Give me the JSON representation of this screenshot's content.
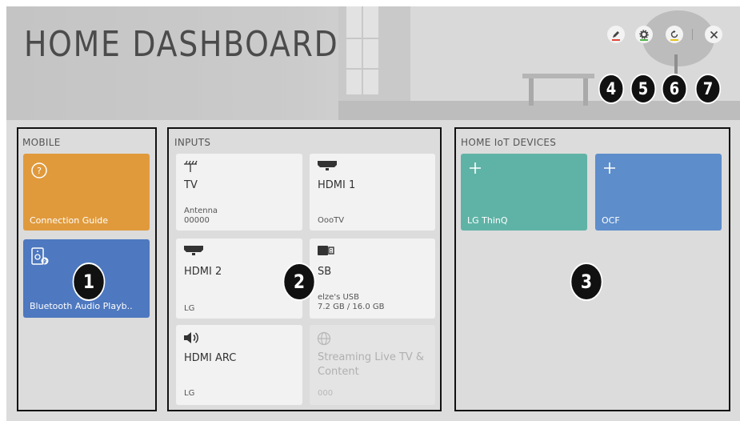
{
  "header": {
    "title": "HOME DASHBOARD",
    "buttons": [
      {
        "icon": "edit-icon",
        "underline": "#e0483c"
      },
      {
        "icon": "gear-icon",
        "underline": "#4fb54a"
      },
      {
        "icon": "refresh-icon",
        "underline": "#e8c11f"
      },
      {
        "icon": "close-icon"
      }
    ]
  },
  "callouts": [
    "1",
    "2",
    "3",
    "4",
    "5",
    "6",
    "7"
  ],
  "mobile": {
    "title": "MOBILE",
    "tiles": [
      {
        "label": "Connection Guide",
        "icon": "help-circle-icon",
        "color": "#e09a3c"
      },
      {
        "label": "Bluetooth Audio Playb..",
        "icon": "speaker-bluetooth-icon",
        "color": "#4e78bf"
      }
    ]
  },
  "inputs": {
    "title": "INPUTS",
    "cards": [
      {
        "name": "TV",
        "icon": "antenna-icon",
        "sub1": "Antenna",
        "sub2": "00000"
      },
      {
        "name": "HDMI 1",
        "icon": "hdmi-icon",
        "sub1": "",
        "sub2": "OooTV"
      },
      {
        "name": "HDMI 2",
        "icon": "hdmi-icon",
        "sub1": "",
        "sub2": "LG"
      },
      {
        "name": "SB",
        "icon": "usb-icon",
        "sub1": "elze's USB",
        "sub2": "7.2 GB / 16.0 GB"
      },
      {
        "name": "HDMI ARC",
        "icon": "speaker-icon",
        "sub1": "",
        "sub2": "LG"
      },
      {
        "name": "Streaming Live TV & Content",
        "icon": "globe-icon",
        "sub1": "",
        "sub2": "000"
      }
    ]
  },
  "iot": {
    "title": "HOME IoT DEVICES",
    "tiles": [
      {
        "label": "LG ThinQ",
        "icon": "plus-icon",
        "color": "#5fb3a6"
      },
      {
        "label": "OCF",
        "icon": "plus-icon",
        "color": "#5d8dca"
      }
    ]
  }
}
